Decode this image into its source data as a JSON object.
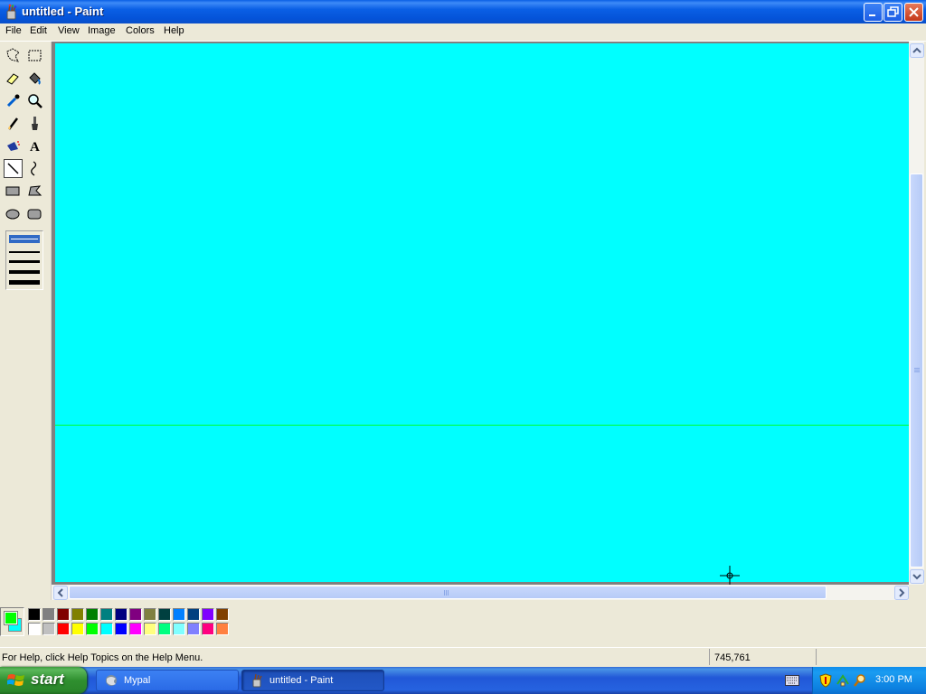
{
  "window": {
    "title": "untitled - Paint",
    "icon": "paint-brush-cup-icon",
    "controls": [
      "minimize-icon",
      "maximize-icon",
      "close-icon"
    ]
  },
  "menu": {
    "items": [
      "File",
      "Edit",
      "View",
      "Image",
      "Colors",
      "Help"
    ]
  },
  "toolbox": {
    "tools": [
      {
        "name": "free-form-select-icon"
      },
      {
        "name": "select-icon"
      },
      {
        "name": "eraser-icon"
      },
      {
        "name": "fill-with-color-icon"
      },
      {
        "name": "pick-color-icon"
      },
      {
        "name": "magnifier-icon"
      },
      {
        "name": "pencil-icon"
      },
      {
        "name": "brush-icon"
      },
      {
        "name": "airbrush-icon"
      },
      {
        "name": "text-icon",
        "glyph": "A"
      },
      {
        "name": "line-icon",
        "active": true
      },
      {
        "name": "curve-icon"
      },
      {
        "name": "rectangle-icon"
      },
      {
        "name": "polygon-icon"
      },
      {
        "name": "ellipse-icon"
      },
      {
        "name": "rounded-rectangle-icon"
      }
    ],
    "line_widths": [
      1,
      2,
      3,
      4
    ],
    "selected_line_width": 1
  },
  "canvas": {
    "background_color": "#00ffff",
    "drawn_line_color": "#00ff00"
  },
  "colors": {
    "foreground": "#00ff00",
    "background": "#00ffff",
    "palette_top": [
      "#000000",
      "#808080",
      "#800000",
      "#808000",
      "#008000",
      "#008080",
      "#000080",
      "#800080",
      "#808040",
      "#004040",
      "#0080ff",
      "#004080",
      "#8000ff",
      "#804000"
    ],
    "palette_bottom": [
      "#ffffff",
      "#c0c0c0",
      "#ff0000",
      "#ffff00",
      "#00ff00",
      "#00ffff",
      "#0000ff",
      "#ff00ff",
      "#ffff80",
      "#00ff80",
      "#80ffff",
      "#8080ff",
      "#ff0080",
      "#ff8040"
    ]
  },
  "status": {
    "help_text": "For Help, click Help Topics on the Help Menu.",
    "coordinates": "745,761"
  },
  "taskbar": {
    "start_label": "start",
    "tasks": [
      {
        "label": "Mypal",
        "icon": "mypal-browser-icon"
      },
      {
        "label": "untitled - Paint",
        "icon": "paint-brush-cup-icon",
        "active": true
      }
    ],
    "clock": "3:00 PM"
  }
}
